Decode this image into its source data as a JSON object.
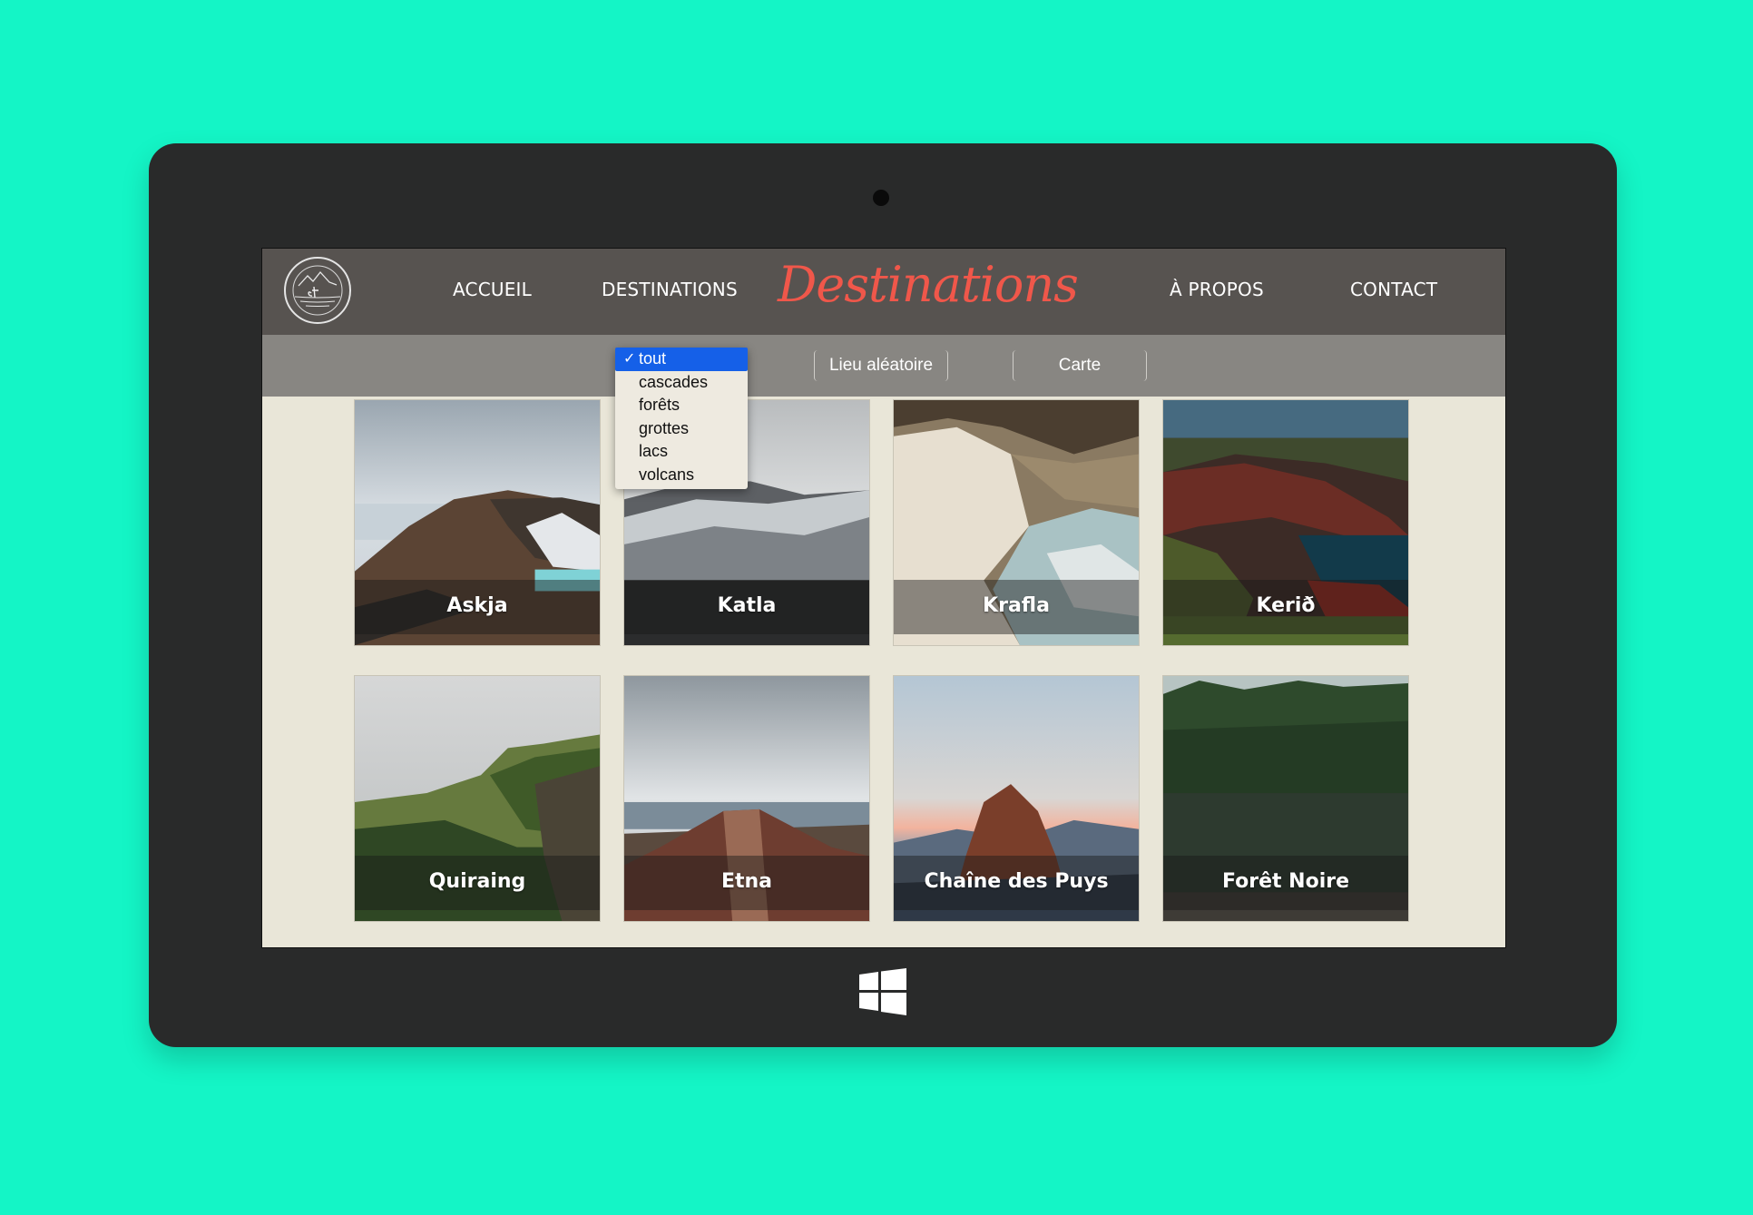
{
  "nav": {
    "accueil": "ACCUEIL",
    "destinations": "DESTINATIONS",
    "title": "Destinations",
    "a_propos": "À PROPOS",
    "contact": "CONTACT"
  },
  "filter": {
    "options": [
      "tout",
      "cascades",
      "forêts",
      "grottes",
      "lacs",
      "volcans"
    ],
    "selected": "tout",
    "check_mark": "✓",
    "random_button": "Lieu aléatoire",
    "map_button": "Carte"
  },
  "destinations": [
    {
      "name": "Askja"
    },
    {
      "name": "Katla"
    },
    {
      "name": "Krafla"
    },
    {
      "name": "Kerið"
    },
    {
      "name": "Quiraing"
    },
    {
      "name": "Etna"
    },
    {
      "name": "Chaîne des Puys"
    },
    {
      "name": "Forêt Noire"
    }
  ],
  "colors": {
    "background": "#14f5c6",
    "device": "#292a2a",
    "header": "#575350",
    "filterbar": "#888682",
    "content": "#e9e6d8",
    "title_accent": "#f0574a",
    "dropdown_selected": "#1560e8"
  }
}
